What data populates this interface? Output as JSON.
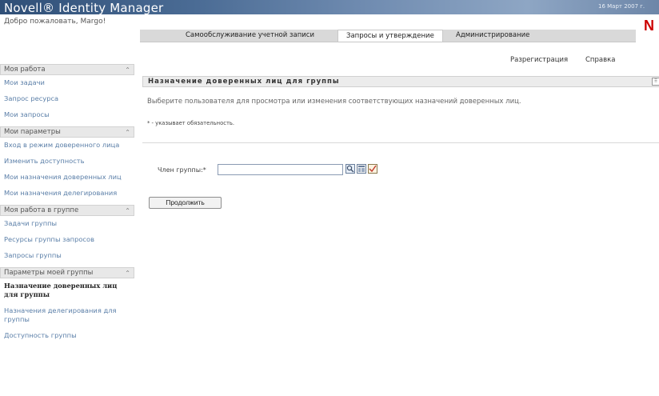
{
  "header": {
    "app_title": "Novell® Identity Manager",
    "date": "16 Март 2007 г.",
    "welcome": "Добро пожаловать, Margo!",
    "brand_letter": "N"
  },
  "tabs": [
    {
      "label": "Самообслуживание учетной записи"
    },
    {
      "label": "Запросы и утверждение"
    },
    {
      "label": "Администрирование"
    }
  ],
  "toplinks": {
    "logout": "Разрегистрация",
    "help": "Справка"
  },
  "sidebar": {
    "sections": [
      {
        "title": "Моя работа",
        "items": [
          "Мои задачи",
          "Запрос ресурса",
          "Мои запросы"
        ]
      },
      {
        "title": "Мои параметры",
        "items": [
          "Вход в режим доверенного лица",
          "Изменить доступность",
          "Мои назначения доверенных лиц",
          "Мои назначения делегирования"
        ]
      },
      {
        "title": "Моя работа в группе",
        "items": [
          "Задачи группы",
          "Ресурсы группы запросов",
          "Запросы группы"
        ]
      },
      {
        "title": "Параметры моей группы",
        "items": [
          "Назначение доверенных лиц для группы",
          "Назначения делегирования для группы",
          "Доступность группы"
        ]
      }
    ]
  },
  "main": {
    "title": "Назначение доверенных лиц для группы",
    "instructions": "Выберите пользователя для просмотра или изменения соответствующих назначений доверенных лиц.",
    "required_note": "* - указывает обязательность.",
    "field_label": "Член группы:*",
    "field_value": "",
    "continue_label": "Продолжить"
  },
  "colors": {
    "link": "#5b7fa8",
    "brand_red": "#cc0000",
    "header_blue": "#2f4f77"
  }
}
